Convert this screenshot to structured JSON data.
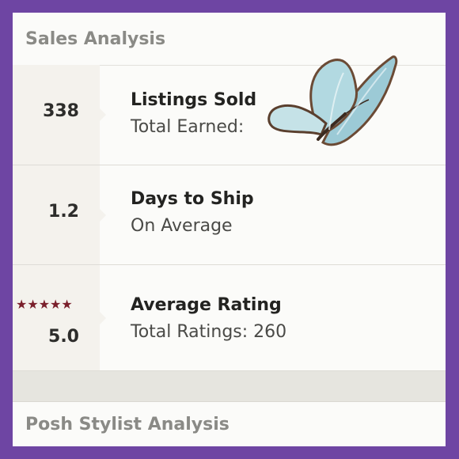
{
  "sales_header": "Sales Analysis",
  "rows": [
    {
      "value": "338",
      "title": "Listings Sold",
      "subtitle": "Total Earned:"
    },
    {
      "value": "1.2",
      "title": "Days to Ship",
      "subtitle": "On Average"
    },
    {
      "value": "5.0",
      "stars": "★★★★★",
      "star_rating": 5,
      "title": "Average Rating",
      "subtitle": "Total Ratings: 260"
    }
  ],
  "posh_header": "Posh Stylist Analysis",
  "colors": {
    "frame": "#6e45a3",
    "panel": "#fbfbf9",
    "metric_bg": "#f4f2ed",
    "star": "#7a1f2b",
    "butterfly_wing": "#a9d3dc",
    "butterfly_edge": "#6b4a35"
  },
  "icons": {
    "decoration": "butterfly-icon",
    "rating": "star-icon"
  }
}
